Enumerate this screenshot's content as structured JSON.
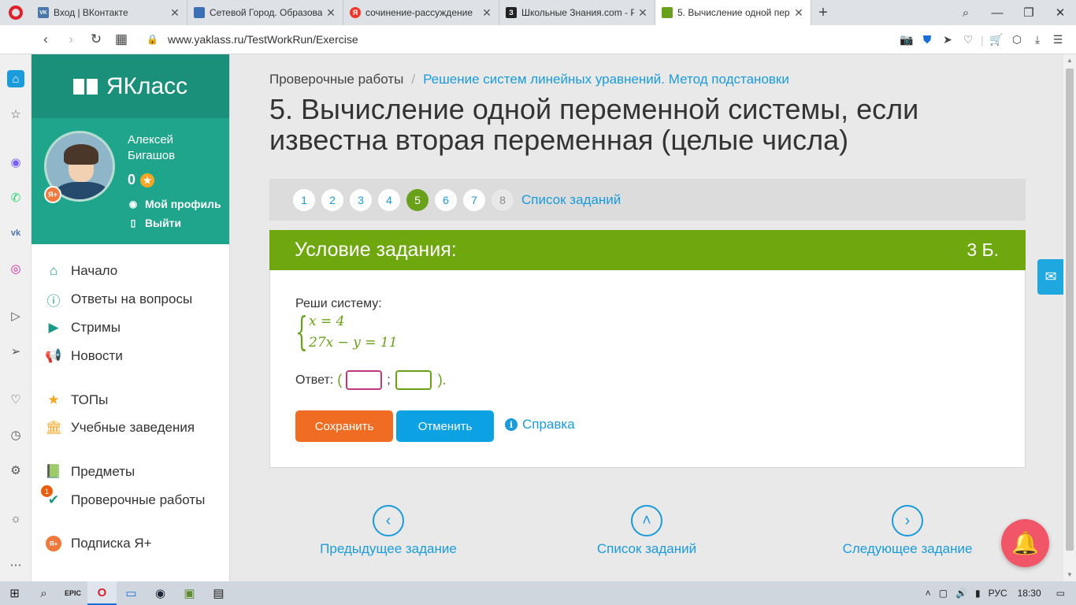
{
  "browser": {
    "tabs": [
      {
        "title": "Вход | ВКонтакте",
        "favicon_color": "#4a76a8",
        "favicon_letter": "VK",
        "active": false
      },
      {
        "title": "Сетевой Город. Образова",
        "favicon_color": "#3b6fb6",
        "favicon_letter": "",
        "active": false
      },
      {
        "title": "сочинение-рассуждение",
        "favicon_color": "#f0362b",
        "favicon_letter": "Я",
        "active": false
      },
      {
        "title": "Школьные Знания.com - Р",
        "favicon_color": "#222222",
        "favicon_letter": "З",
        "active": false
      },
      {
        "title": "5. Вычисление одной пер",
        "favicon_color": "#6aa11b",
        "favicon_letter": "",
        "active": true
      }
    ],
    "url": "www.yaklass.ru/TestWorkRun/Exercise"
  },
  "site": {
    "logo_text": "ЯКласс",
    "user": {
      "name": "Алексей Бигашов",
      "score": "0",
      "profile_link": "Мой профиль",
      "logout_link": "Выйти",
      "plus_badge": "Я+"
    },
    "menu": [
      {
        "label": "Начало",
        "icon": "home-icon"
      },
      {
        "label": "Ответы на вопросы",
        "icon": "question-icon"
      },
      {
        "label": "Стримы",
        "icon": "play-icon"
      },
      {
        "label": "Новости",
        "icon": "megaphone-icon"
      },
      {
        "label": "ТОПы",
        "icon": "star-icon"
      },
      {
        "label": "Учебные заведения",
        "icon": "building-icon"
      },
      {
        "label": "Предметы",
        "icon": "books-icon"
      },
      {
        "label": "Проверочные работы",
        "icon": "check-icon",
        "badge": "1"
      },
      {
        "label": "Подписка Я+",
        "icon": "plus-icon",
        "icon_text": "Я+"
      }
    ]
  },
  "breadcrumb": {
    "root": "Проверочные работы",
    "current": "Решение систем линейных уравнений. Метод подстановки"
  },
  "title": "5. Вычисление одной переменной системы, если известна вторая переменная (целые числа)",
  "steps": {
    "items": [
      "1",
      "2",
      "3",
      "4",
      "5",
      "6",
      "7",
      "8"
    ],
    "current": "5",
    "list_link": "Список заданий"
  },
  "task": {
    "header": "Условие задания:",
    "points": "3 Б.",
    "prompt": "Реши систему:",
    "equation_1": "x = 4",
    "equation_2": "27x − y = 11",
    "answer_label": "Ответ:",
    "open_paren": "(",
    "semicolon": ";",
    "close_paren": ").",
    "answer_x": "",
    "answer_y": "",
    "save_button": "Сохранить",
    "cancel_button": "Отменить",
    "help_link": "Справка"
  },
  "bottom_nav": {
    "prev": "Предыдущее задание",
    "list": "Список заданий",
    "next": "Следующее задание"
  },
  "taskbar": {
    "language": "РУС",
    "time": "18:30"
  },
  "colors": {
    "brand_green": "#6fa80e",
    "brand_teal": "#1fa58b",
    "link_blue": "#1a9bdb",
    "save_orange": "#ef6c22",
    "cancel_blue": "#0ba1e3"
  }
}
